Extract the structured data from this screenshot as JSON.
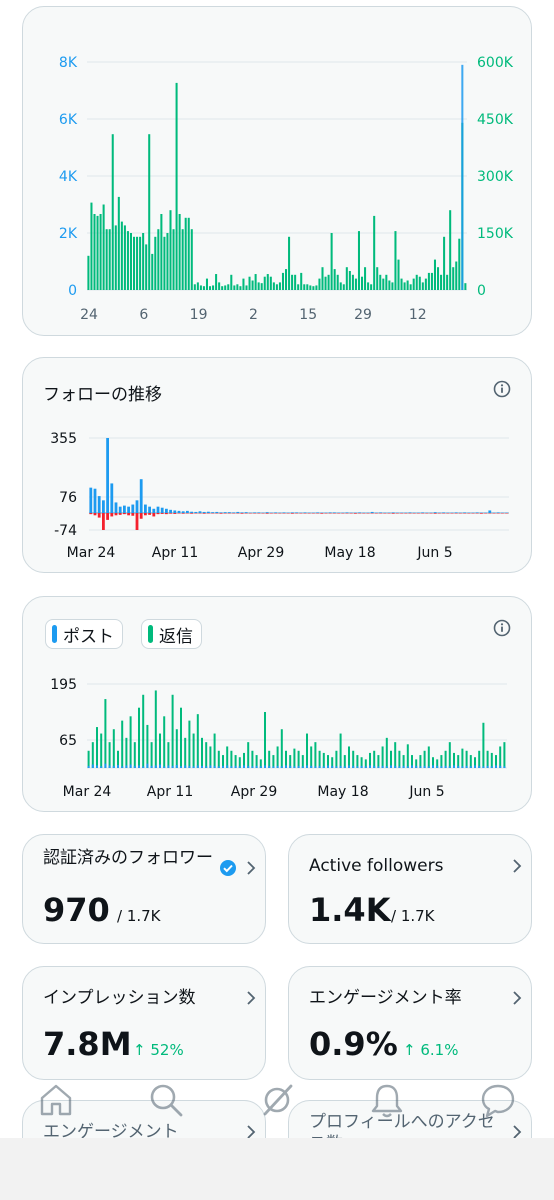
{
  "colors": {
    "blue": "#1d9bf0",
    "green": "#00ba7c",
    "red": "#f4212e",
    "grid": "#dfe6ea",
    "text_muted": "#536471",
    "card_bg": "#f7f9f9",
    "border": "#cfd9de"
  },
  "impressions_chart": {
    "chart_data": {
      "type": "bar",
      "title": "",
      "x_tick_labels": [
        "24",
        "6",
        "19",
        "2",
        "15",
        "29",
        "12"
      ],
      "y_left_ticks": [
        "0",
        "2K",
        "4K",
        "6K",
        "8K"
      ],
      "y_right_ticks": [
        "0",
        "150K",
        "300K",
        "450K",
        "600K"
      ],
      "ylim_left": [
        0,
        8000
      ],
      "ylim_right": [
        0,
        600000
      ],
      "grid": true,
      "series": [
        {
          "color": "#00ba7c",
          "axis": "right",
          "values": [
            90000,
            230000,
            200000,
            195000,
            200000,
            225000,
            160000,
            160000,
            410000,
            170000,
            245000,
            180000,
            170000,
            155000,
            150000,
            140000,
            140000,
            140000,
            150000,
            120000,
            410000,
            95000,
            140000,
            160000,
            200000,
            140000,
            150000,
            210000,
            160000,
            545000,
            200000,
            160000,
            190000,
            190000,
            160000,
            15000,
            20000,
            12000,
            10000,
            30000,
            10000,
            12000,
            42000,
            20000,
            10000,
            12000,
            15000,
            40000,
            12000,
            15000,
            10000,
            30000,
            12000,
            35000,
            25000,
            42000,
            20000,
            18000,
            35000,
            42000,
            35000,
            20000,
            15000,
            20000,
            45000,
            55000,
            140000,
            40000,
            40000,
            15000,
            45000,
            15000,
            15000,
            12000,
            10000,
            12000,
            30000,
            60000,
            35000,
            40000,
            150000,
            55000,
            40000,
            20000,
            15000,
            60000,
            50000,
            40000,
            30000,
            155000,
            35000,
            60000,
            20000,
            15000,
            195000,
            60000,
            40000,
            30000,
            40000,
            25000,
            20000,
            155000,
            80000,
            30000,
            20000,
            25000,
            15000,
            30000,
            40000,
            35000,
            20000,
            30000,
            45000,
            45000,
            80000,
            60000,
            40000,
            140000,
            40000,
            210000,
            60000,
            75000,
            135000,
            440000,
            18000
          ]
        },
        {
          "color": "#1d9bf0",
          "axis": "left",
          "values": [
            0,
            0,
            0,
            0,
            0,
            0,
            0,
            0,
            0,
            0,
            0,
            0,
            0,
            0,
            0,
            0,
            0,
            0,
            0,
            0,
            0,
            0,
            0,
            0,
            0,
            0,
            0,
            0,
            0,
            0,
            0,
            0,
            0,
            0,
            0,
            0,
            0,
            0,
            0,
            0,
            0,
            0,
            0,
            0,
            0,
            0,
            0,
            0,
            0,
            0,
            0,
            0,
            0,
            0,
            0,
            0,
            0,
            0,
            0,
            0,
            0,
            0,
            0,
            0,
            0,
            0,
            0,
            0,
            0,
            0,
            0,
            0,
            0,
            0,
            0,
            0,
            0,
            0,
            0,
            0,
            0,
            0,
            0,
            0,
            0,
            0,
            0,
            0,
            0,
            0,
            0,
            0,
            0,
            0,
            0,
            0,
            0,
            0,
            0,
            0,
            0,
            0,
            0,
            0,
            0,
            0,
            0,
            0,
            0,
            0,
            0,
            0,
            0,
            0,
            0,
            0,
            0,
            0,
            0,
            0,
            0,
            0,
            0,
            7900,
            0
          ]
        }
      ]
    }
  },
  "follows_card": {
    "title": "フォローの推移",
    "chart_data": {
      "type": "bar",
      "x_tick_labels": [
        "Mar 24",
        "Apr 11",
        "Apr 29",
        "May 18",
        "Jun 5"
      ],
      "y_ticks": [
        "-74",
        "76",
        "355"
      ],
      "ylim": [
        -74,
        355
      ],
      "grid": true,
      "series": [
        {
          "color": "#1d9bf0",
          "values": [
            120,
            115,
            80,
            60,
            355,
            140,
            50,
            30,
            35,
            30,
            40,
            60,
            160,
            40,
            30,
            20,
            30,
            25,
            20,
            15,
            12,
            10,
            8,
            10,
            6,
            5,
            8,
            5,
            6,
            4,
            5,
            3,
            4,
            4,
            3,
            5,
            3,
            4,
            2,
            3,
            3,
            2,
            4,
            2,
            3,
            2,
            3,
            2,
            3,
            3,
            2,
            3,
            2,
            2,
            3,
            2,
            2,
            3,
            3,
            2,
            2,
            3,
            2,
            2,
            3,
            2,
            2,
            5,
            2,
            3,
            2,
            2,
            3,
            2,
            2,
            2,
            3,
            2,
            2,
            3,
            2,
            2,
            4,
            2,
            3,
            2,
            2,
            3,
            2,
            3,
            2,
            2,
            3,
            2,
            2,
            12,
            2,
            3,
            2,
            2
          ]
        },
        {
          "color": "#f4212e",
          "values": [
            -5,
            -10,
            -20,
            -74,
            -30,
            -15,
            -10,
            -8,
            -5,
            -10,
            -12,
            -74,
            -25,
            -10,
            -8,
            -15,
            -5,
            -4,
            -5,
            -3,
            -4,
            -2,
            -3,
            -2,
            -3,
            -2,
            -2,
            -3,
            -2,
            -2,
            -2,
            -3,
            -2,
            -2,
            -2,
            -2,
            -3,
            -2,
            -2,
            -2,
            -2,
            -2,
            -3,
            -2,
            -2,
            -2,
            -2,
            -2,
            -3,
            -2,
            -2,
            -2,
            -2,
            -2,
            -2,
            -3,
            -2,
            -2,
            -2,
            -2,
            -2,
            -2,
            -2,
            -3,
            -2,
            -2,
            -2,
            -2,
            -2,
            -2,
            -2,
            -2,
            -3,
            -2,
            -2,
            -2,
            -2,
            -2,
            -2,
            -2,
            -2,
            -2,
            -3,
            -2,
            -2,
            -2,
            -2,
            -2,
            -2,
            -2,
            -2,
            -2,
            -2,
            -3,
            -2,
            -2,
            -2,
            -2,
            -2,
            -2
          ]
        }
      ]
    }
  },
  "posts_card": {
    "legend": [
      {
        "label": "ポスト",
        "color": "#1d9bf0"
      },
      {
        "label": "返信",
        "color": "#00ba7c"
      }
    ],
    "chart_data": {
      "type": "bar",
      "x_tick_labels": [
        "Mar 24",
        "Apr 11",
        "Apr 29",
        "May 18",
        "Jun 5"
      ],
      "y_ticks": [
        "65",
        "195"
      ],
      "ylim": [
        0,
        195
      ],
      "grid": true,
      "series": [
        {
          "name": "ポスト",
          "color": "#1d9bf0",
          "values": [
            5,
            8,
            6,
            4,
            10,
            6,
            5,
            7,
            4,
            6,
            8,
            5,
            6,
            4,
            10,
            5,
            6,
            8,
            4,
            6,
            5,
            7,
            4,
            6,
            5,
            4,
            6,
            5,
            4,
            6,
            5,
            4,
            5,
            6,
            4,
            5,
            4,
            6,
            5,
            4,
            5,
            4,
            6,
            5,
            4,
            5,
            4,
            6,
            5,
            4,
            5,
            4,
            6,
            5,
            4,
            5,
            4,
            6,
            5,
            4,
            5,
            4,
            6,
            5,
            4,
            5,
            4,
            6,
            5,
            4,
            5,
            4,
            6,
            5,
            4,
            5,
            4,
            6,
            5,
            4,
            5,
            4,
            6,
            5,
            4,
            5,
            4,
            6,
            5,
            4,
            5,
            4,
            6,
            5,
            4,
            5,
            4,
            6,
            5,
            4
          ]
        },
        {
          "name": "返信",
          "color": "#00ba7c",
          "values": [
            40,
            60,
            95,
            80,
            160,
            60,
            90,
            40,
            110,
            70,
            120,
            60,
            140,
            170,
            100,
            60,
            180,
            80,
            120,
            60,
            170,
            90,
            140,
            70,
            110,
            80,
            125,
            70,
            60,
            50,
            80,
            40,
            30,
            50,
            40,
            30,
            25,
            35,
            60,
            40,
            30,
            20,
            130,
            40,
            30,
            50,
            90,
            40,
            30,
            45,
            40,
            30,
            80,
            50,
            60,
            40,
            35,
            30,
            25,
            40,
            80,
            30,
            50,
            40,
            30,
            25,
            20,
            35,
            40,
            30,
            50,
            70,
            40,
            60,
            40,
            30,
            55,
            30,
            20,
            30,
            40,
            50,
            25,
            20,
            30,
            40,
            60,
            35,
            30,
            45,
            40,
            30,
            25,
            40,
            105,
            40,
            35,
            30,
            50,
            60
          ]
        }
      ]
    }
  },
  "stats": {
    "verified": {
      "label": "認証済みのフォロワー",
      "value": "970",
      "total": "/ 1.7K"
    },
    "active": {
      "label": "Active followers",
      "value": "1.4K",
      "total": "/ 1.7K"
    },
    "impressions": {
      "label": "インプレッション数",
      "value": "7.8M",
      "change": "52%"
    },
    "engagement_rate": {
      "label": "エンゲージメント率",
      "value": "0.9%",
      "change": "6.1%"
    },
    "engagements": {
      "label": "エンゲージメント"
    },
    "profile_visits": {
      "label": "プロフィールへのアクセス数"
    }
  },
  "nav": [
    "home-icon",
    "search-icon",
    "grok-icon",
    "notifications-icon",
    "messages-icon"
  ]
}
